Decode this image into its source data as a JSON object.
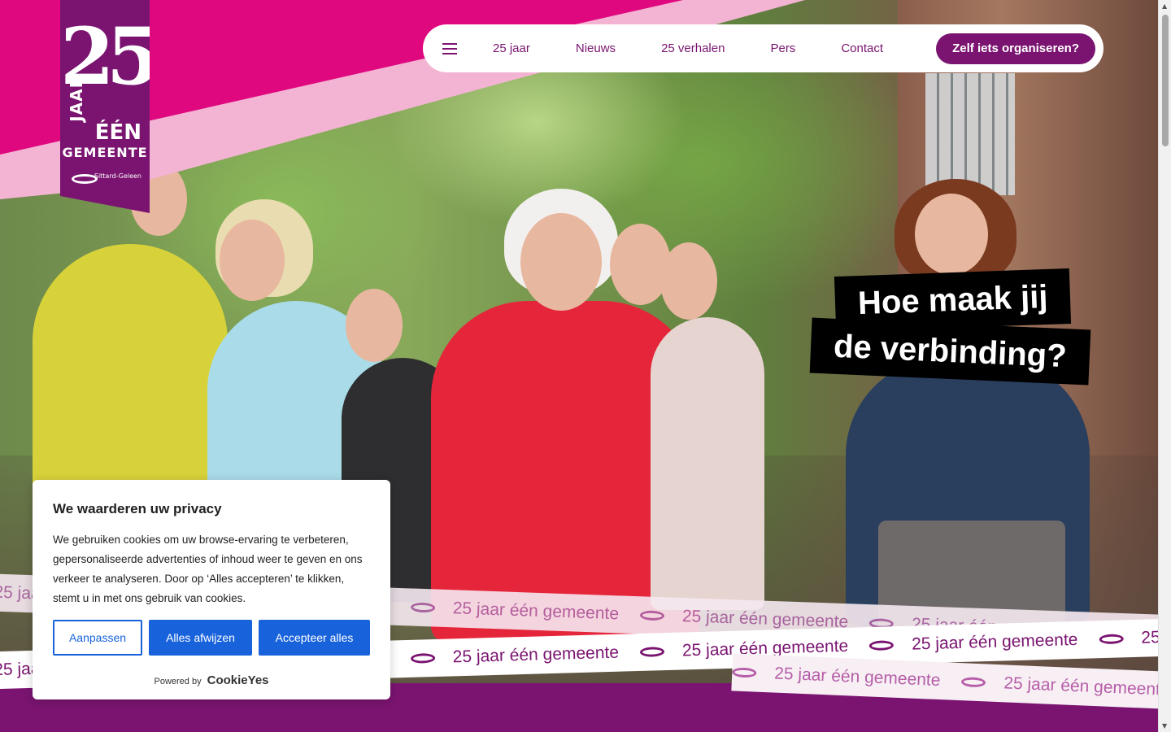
{
  "brand": {
    "logo_number": "25",
    "logo_line1": "JAAR",
    "logo_line2": "ÉÉN",
    "logo_line3": "GEMEENTE",
    "logo_municipality": "Sittard-Geleen",
    "colors": {
      "primary": "#7a1470",
      "pink": "#e0087f",
      "pink_light": "#f3b4d3",
      "cookie_blue": "#1863dc"
    }
  },
  "nav": {
    "menu_icon": "hamburger-icon",
    "items": [
      "25 jaar",
      "Nieuws",
      "25 verhalen",
      "Pers",
      "Contact"
    ],
    "cta": "Zelf iets organiseren?"
  },
  "hero": {
    "headline_line1": "Hoe maak jij",
    "headline_line2": "de verbinding?"
  },
  "ribbon": {
    "text": "25 jaar één gemeente",
    "icon": "swoosh-icon"
  },
  "cookie": {
    "title": "We waarderen uw privacy",
    "body": "We gebruiken cookies om uw browse-ervaring te verbeteren, gepersonaliseerde advertenties of inhoud weer te geven en ons verkeer te analyseren. Door op ‘Alles accepteren’ te klikken, stemt u in met ons gebruik van cookies.",
    "customize": "Aanpassen",
    "reject": "Alles afwijzen",
    "accept": "Accepteer alles",
    "powered_by": "Powered by",
    "vendor": "CookieYes"
  }
}
